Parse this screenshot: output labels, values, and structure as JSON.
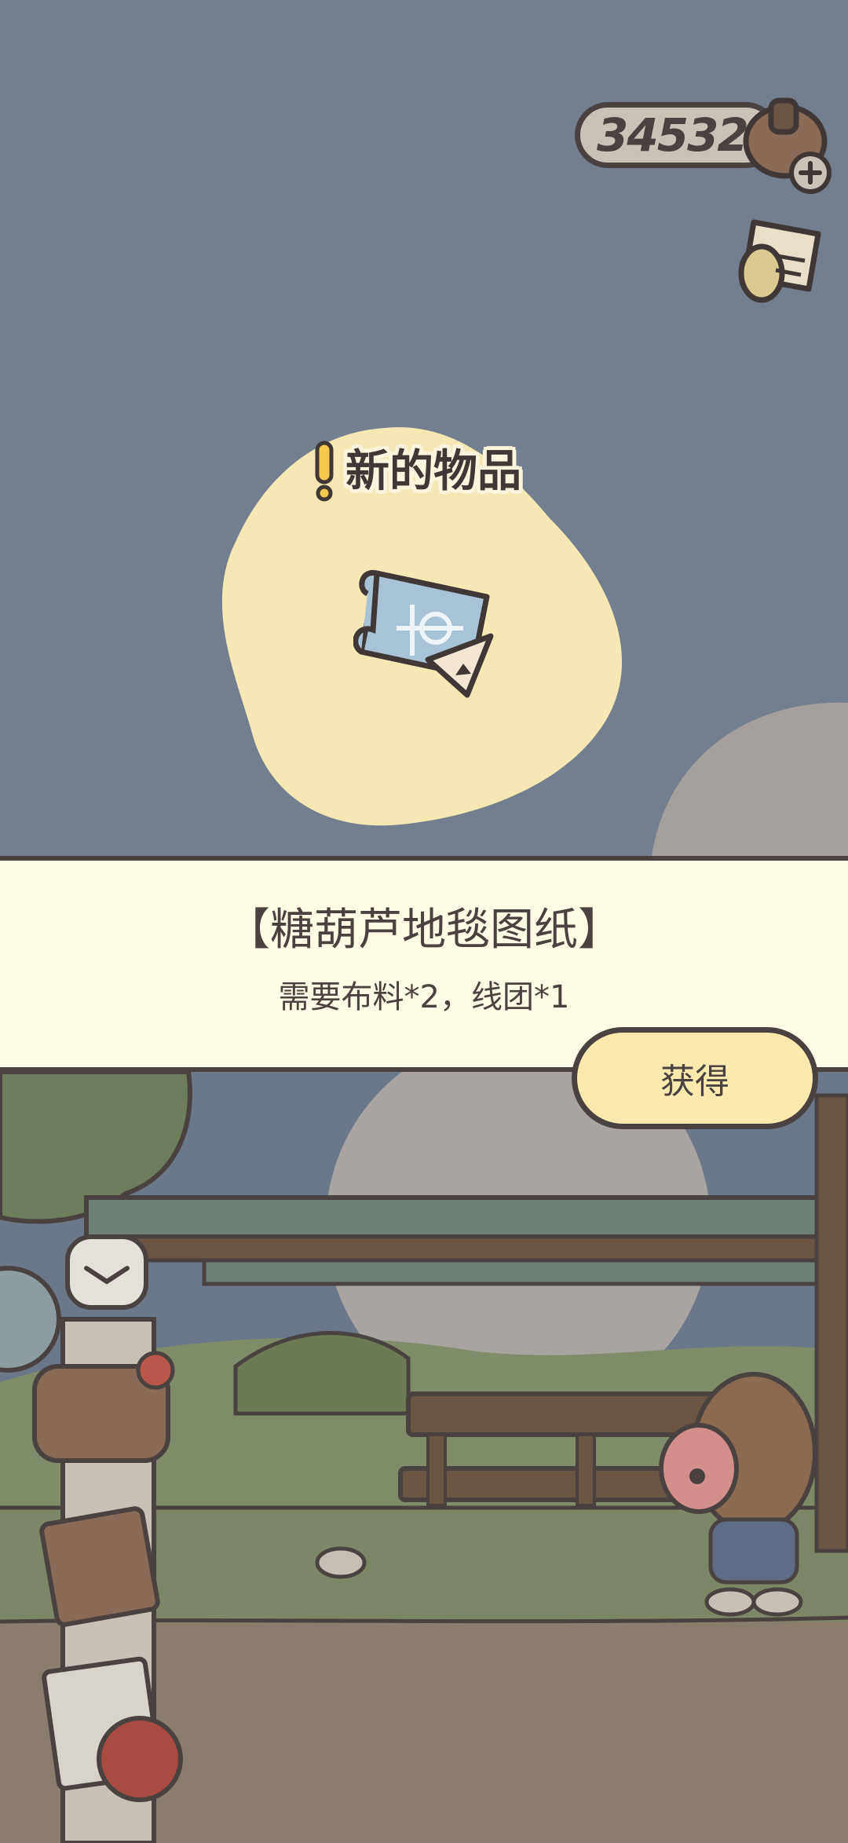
{
  "hud": {
    "currency_value": "345321",
    "currency_icon": "acorn-coin-icon",
    "add_icon": "plus-icon",
    "side_icon": "scroll-note-icon"
  },
  "reward": {
    "new_item_label": "新的物品",
    "alert_icon": "exclamation-icon",
    "item_icon": "blueprint-scroll-icon"
  },
  "item": {
    "title": "【糖葫芦地毯图纸】",
    "requirements": "需要布料*2，线团*1"
  },
  "actions": {
    "get_label": "获得"
  },
  "colors": {
    "sky": "#737f8e",
    "blob": "#f5e8b4",
    "banner": "#fefbe6",
    "button": "#fbe9ad",
    "outline": "#4a4240"
  }
}
